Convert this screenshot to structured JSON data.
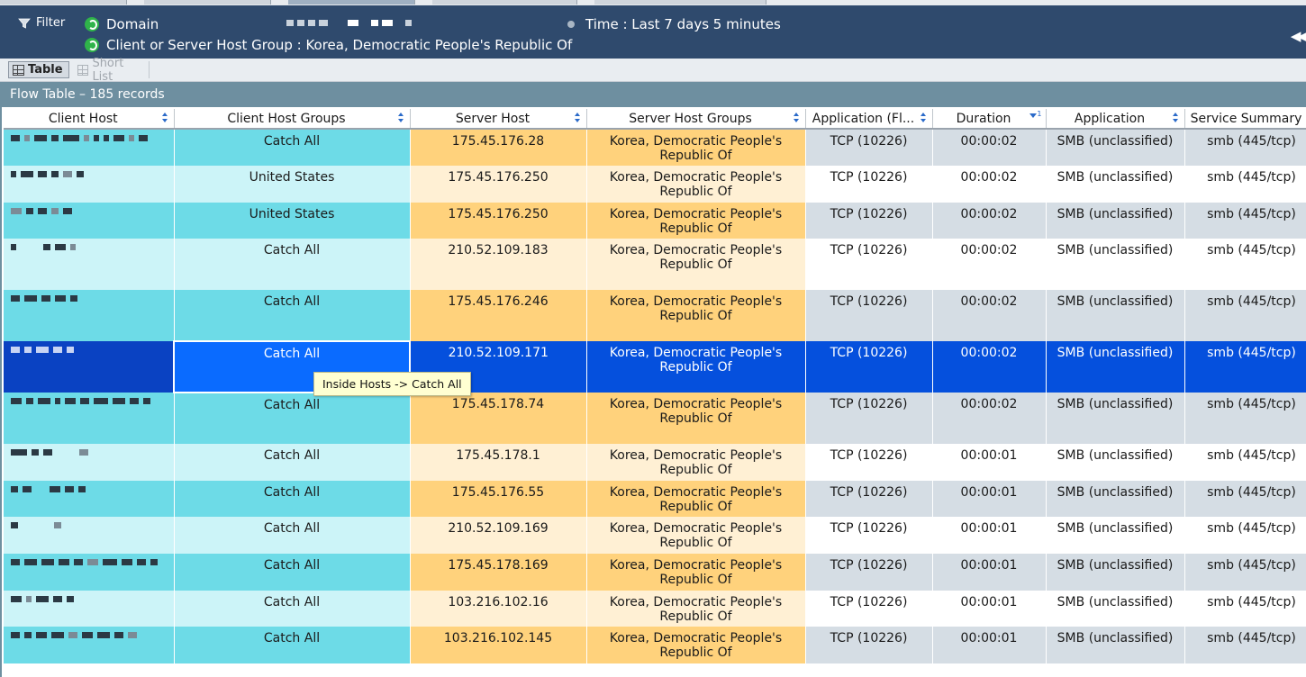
{
  "filter_bar": {
    "filter_label": "Filter",
    "criteria": [
      {
        "label": "Domain"
      },
      {
        "label": "Client or Server Host Group : Korea, Democratic People's Republic Of"
      }
    ],
    "time_label": "Time : Last 7 days 5 minutes"
  },
  "view_toolbar": {
    "table_label": "Table",
    "short_list_label": "Short List"
  },
  "panel": {
    "title": "Flow Table – 185 records"
  },
  "table": {
    "columns": [
      {
        "label": "Client Host"
      },
      {
        "label": "Client Host Groups"
      },
      {
        "label": "Server Host"
      },
      {
        "label": "Server Host Groups"
      },
      {
        "label": "Application (Fl..."
      },
      {
        "label": "Duration",
        "sort_rank": "1"
      },
      {
        "label": "Application"
      },
      {
        "label": "Service Summary"
      }
    ],
    "rows": [
      {
        "client_host_groups": "Catch All",
        "server_host": "175.45.176.28",
        "server_host_groups": "Korea, Democratic People's Republic Of",
        "app_flow": "TCP (10226)",
        "duration": "00:00:02",
        "application": "SMB (unclassified)",
        "service_summary": "smb (445/tcp)"
      },
      {
        "client_host_groups": "United States",
        "server_host": "175.45.176.250",
        "server_host_groups": "Korea, Democratic People's Republic Of",
        "app_flow": "TCP (10226)",
        "duration": "00:00:02",
        "application": "SMB (unclassified)",
        "service_summary": "smb (445/tcp)"
      },
      {
        "client_host_groups": "United States",
        "server_host": "175.45.176.250",
        "server_host_groups": "Korea, Democratic People's Republic Of",
        "app_flow": "TCP (10226)",
        "duration": "00:00:02",
        "application": "SMB (unclassified)",
        "service_summary": "smb (445/tcp)"
      },
      {
        "client_host_groups": "Catch All",
        "server_host": "210.52.109.183",
        "server_host_groups": "Korea, Democratic People's Republic Of",
        "app_flow": "TCP (10226)",
        "duration": "00:00:02",
        "application": "SMB (unclassified)",
        "service_summary": "smb (445/tcp)"
      },
      {
        "client_host_groups": "Catch All",
        "server_host": "175.45.176.246",
        "server_host_groups": "Korea, Democratic People's Republic Of",
        "app_flow": "TCP (10226)",
        "duration": "00:00:02",
        "application": "SMB (unclassified)",
        "service_summary": "smb (445/tcp)"
      },
      {
        "client_host_groups": "Catch All",
        "server_host": "210.52.109.171",
        "server_host_groups": "Korea, Democratic People's Republic Of",
        "app_flow": "TCP (10226)",
        "duration": "00:00:02",
        "application": "SMB (unclassified)",
        "service_summary": "smb (445/tcp)"
      },
      {
        "client_host_groups": "Catch All",
        "server_host": "175.45.178.74",
        "server_host_groups": "Korea, Democratic People's Republic Of",
        "app_flow": "TCP (10226)",
        "duration": "00:00:02",
        "application": "SMB (unclassified)",
        "service_summary": "smb (445/tcp)"
      },
      {
        "client_host_groups": "Catch All",
        "server_host": "175.45.178.1",
        "server_host_groups": "Korea, Democratic People's Republic Of",
        "app_flow": "TCP (10226)",
        "duration": "00:00:01",
        "application": "SMB (unclassified)",
        "service_summary": "smb (445/tcp)"
      },
      {
        "client_host_groups": "Catch All",
        "server_host": "175.45.176.55",
        "server_host_groups": "Korea, Democratic People's Republic Of",
        "app_flow": "TCP (10226)",
        "duration": "00:00:01",
        "application": "SMB (unclassified)",
        "service_summary": "smb (445/tcp)"
      },
      {
        "client_host_groups": "Catch All",
        "server_host": "210.52.109.169",
        "server_host_groups": "Korea, Democratic People's Republic Of",
        "app_flow": "TCP (10226)",
        "duration": "00:00:01",
        "application": "SMB (unclassified)",
        "service_summary": "smb (445/tcp)"
      },
      {
        "client_host_groups": "Catch All",
        "server_host": "175.45.178.169",
        "server_host_groups": "Korea, Democratic People's Republic Of",
        "app_flow": "TCP (10226)",
        "duration": "00:00:01",
        "application": "SMB (unclassified)",
        "service_summary": "smb (445/tcp)"
      },
      {
        "client_host_groups": "Catch All",
        "server_host": "103.216.102.16",
        "server_host_groups": "Korea, Democratic People's Republic Of",
        "app_flow": "TCP (10226)",
        "duration": "00:00:01",
        "application": "SMB (unclassified)",
        "service_summary": "smb (445/tcp)"
      },
      {
        "client_host_groups": "Catch All",
        "server_host": "103.216.102.145",
        "server_host_groups": "Korea, Democratic People's Republic Of",
        "app_flow": "TCP (10226)",
        "duration": "00:00:01",
        "application": "SMB (unclassified)",
        "service_summary": "smb (445/tcp)"
      }
    ]
  },
  "tooltip": {
    "text": "Inside Hosts -> Catch All"
  },
  "colors": {
    "header_bar": "#2f4a6d",
    "panel_title_bar": "#6e8fa0",
    "client_cols_odd": "#6ddbe7",
    "client_cols_even": "#ccf4f8",
    "server_cols_odd": "#ffd27c",
    "server_cols_even": "#fff0d4",
    "selected_row": "#0550dd",
    "tooltip_bg": "#ffffd2"
  }
}
